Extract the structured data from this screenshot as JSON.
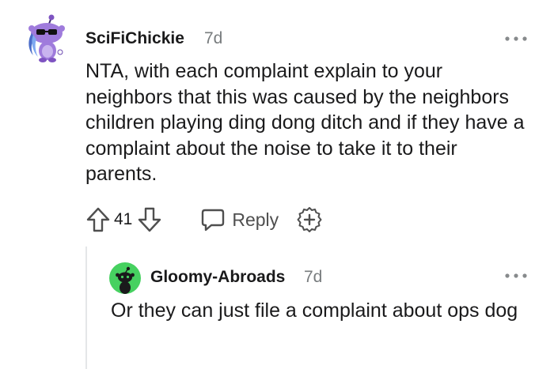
{
  "comment": {
    "username": "SciFiChickie",
    "age": "7d",
    "body": "NTA, with each complaint explain to your neighbors that this was caused by the neighbors children playing ding dong ditch and if they have a complaint about the noise to take it to their parents.",
    "vote_count": "41",
    "reply_label": "Reply",
    "avatar_icon": "snoo-sunglasses-avatar-icon",
    "more_icon": "more-options-icon"
  },
  "reply": {
    "username": "Gloomy-Abroads",
    "age": "7d",
    "body": "Or they can just file a complaint about ops dog",
    "avatar_icon": "snoo-default-avatar-icon",
    "avatar_color": "#46d160",
    "more_icon": "more-options-icon"
  },
  "colors": {
    "meta_text": "#787c7e",
    "body_text": "#1a1a1b",
    "action_gray": "#4f4f4f",
    "thread_line": "#e4e6e8"
  }
}
